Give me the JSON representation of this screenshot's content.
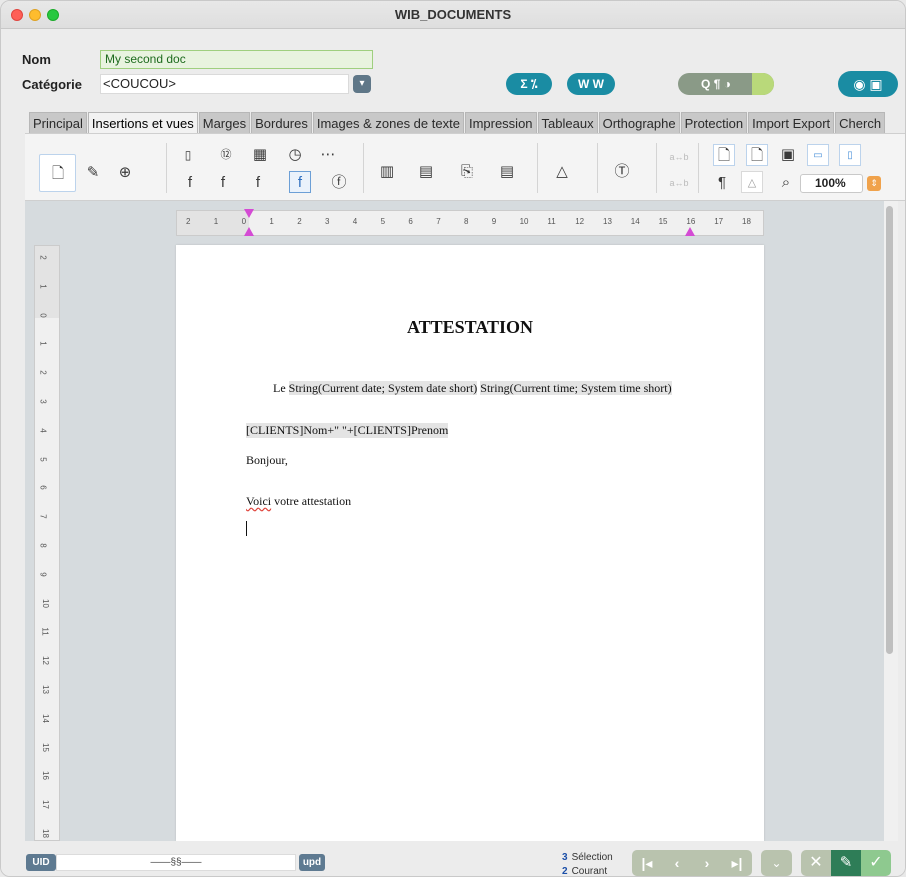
{
  "window": {
    "title": "WIB_DOCUMENTS"
  },
  "form": {
    "nom_label": "Nom",
    "nom_value": "My second doc",
    "categorie_label": "Catégorie",
    "categorie_value": "<COUCOU>"
  },
  "header_buttons": {
    "sigma": "Σ ⁒",
    "word": "W W",
    "search": "Q ¶ ◑",
    "view": "◉ ▣"
  },
  "tabs": [
    "Principal",
    "Insertions et vues",
    "Marges",
    "Bordures",
    "Images & zones de texte",
    "Impression",
    "Tableaux",
    "Orthographe",
    "Protection",
    "Import Export",
    "Cherch"
  ],
  "active_tab": "Insertions et vues",
  "toolbar": {
    "zoom_value": "100%"
  },
  "rulers": {
    "horizontal": [
      "2",
      "1",
      "0",
      "1",
      "2",
      "3",
      "4",
      "5",
      "6",
      "7",
      "8",
      "9",
      "10",
      "11",
      "12",
      "13",
      "14",
      "15",
      "16",
      "17",
      "18"
    ],
    "vertical": [
      "2",
      "1",
      "0",
      "1",
      "2",
      "3",
      "4",
      "5",
      "6",
      "7",
      "8",
      "9",
      "10",
      "11",
      "12",
      "13",
      "14",
      "15",
      "16",
      "17",
      "18"
    ]
  },
  "document": {
    "heading": "ATTESTATION",
    "line1_prefix": "Le ",
    "line1_date": "String(Current date; System date short)",
    "line1_time": "String(Current time; System time short)",
    "line2": "[CLIENTS]Nom+\" \"+[CLIENTS]Prenom",
    "line3": "Bonjour,",
    "line4_word": "Voici",
    "line4_rest": " votre attestation"
  },
  "status": {
    "uid_label": "UID",
    "uid_value": "——§§——",
    "upd_label": "upd",
    "selection_count": "3",
    "selection_label": "Sélection",
    "current_count": "2",
    "current_label": "Courant"
  }
}
